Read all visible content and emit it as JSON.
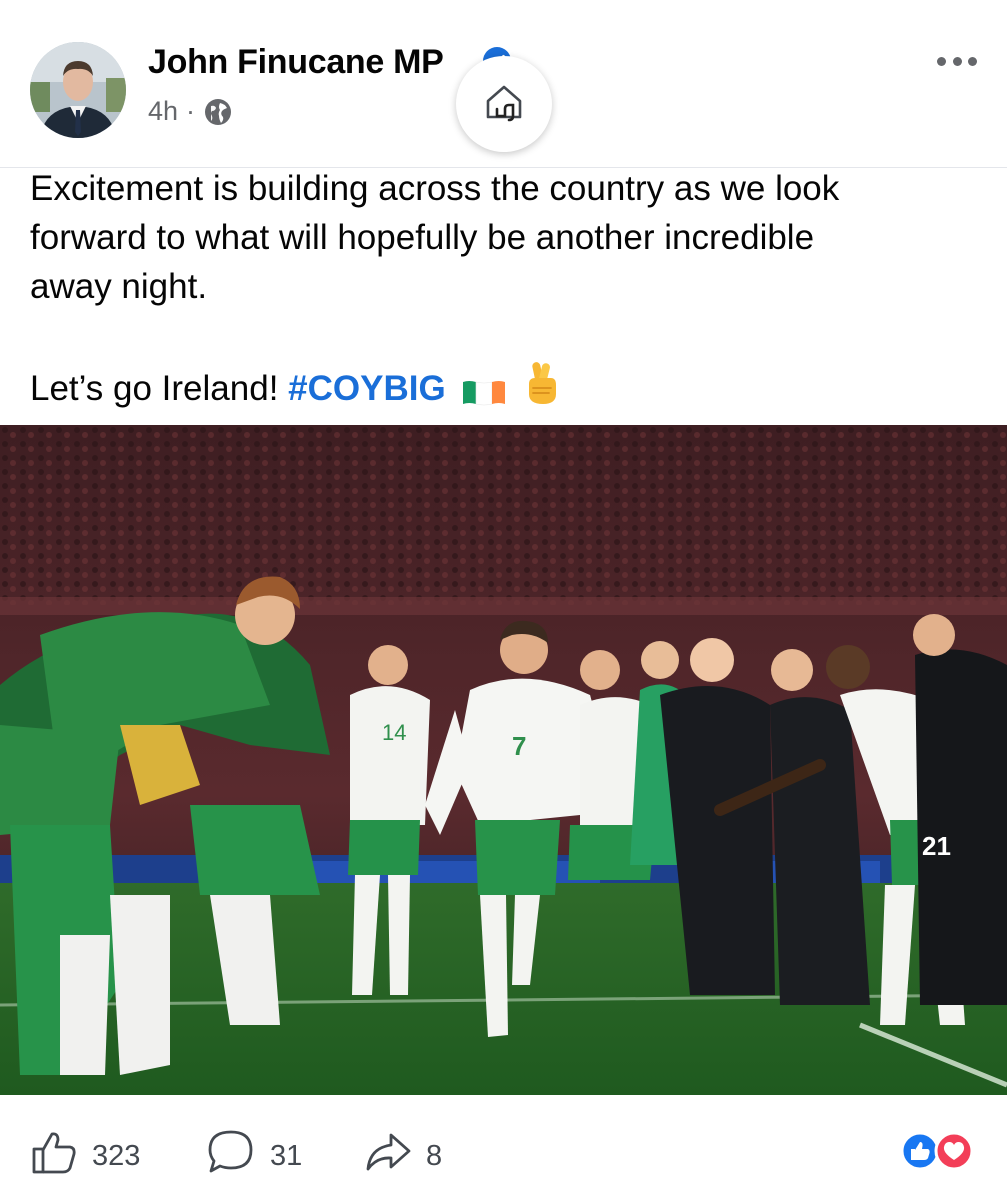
{
  "post": {
    "author": "John Finucane MP",
    "time": "4h",
    "separator": "·",
    "text_lines": [
      "Excitement is building across the country as we look",
      "forward to what will hopefully be another incredible",
      "away night."
    ],
    "closing_text": "Let’s go Ireland!",
    "hashtag": "#COYBIG",
    "emojis": [
      "irish-flag-emoji",
      "crossed-fingers-emoji"
    ]
  },
  "photo": {
    "jersey_numbers": [
      "7",
      "14",
      "21"
    ]
  },
  "actions": {
    "likes": "323",
    "comments": "31",
    "shares": "8"
  },
  "icons": {
    "globe": "globe-icon",
    "verified": "verified-badge-icon",
    "more": "more-options-icon",
    "home": "home-icon",
    "like": "thumbs-up-icon",
    "comment": "comment-icon",
    "share": "share-icon",
    "reaction_like": "like-reaction-icon",
    "reaction_love": "love-reaction-icon"
  },
  "colors": {
    "accent": "#1a6ed8",
    "muted": "#65676b",
    "love": "#f33e58"
  }
}
